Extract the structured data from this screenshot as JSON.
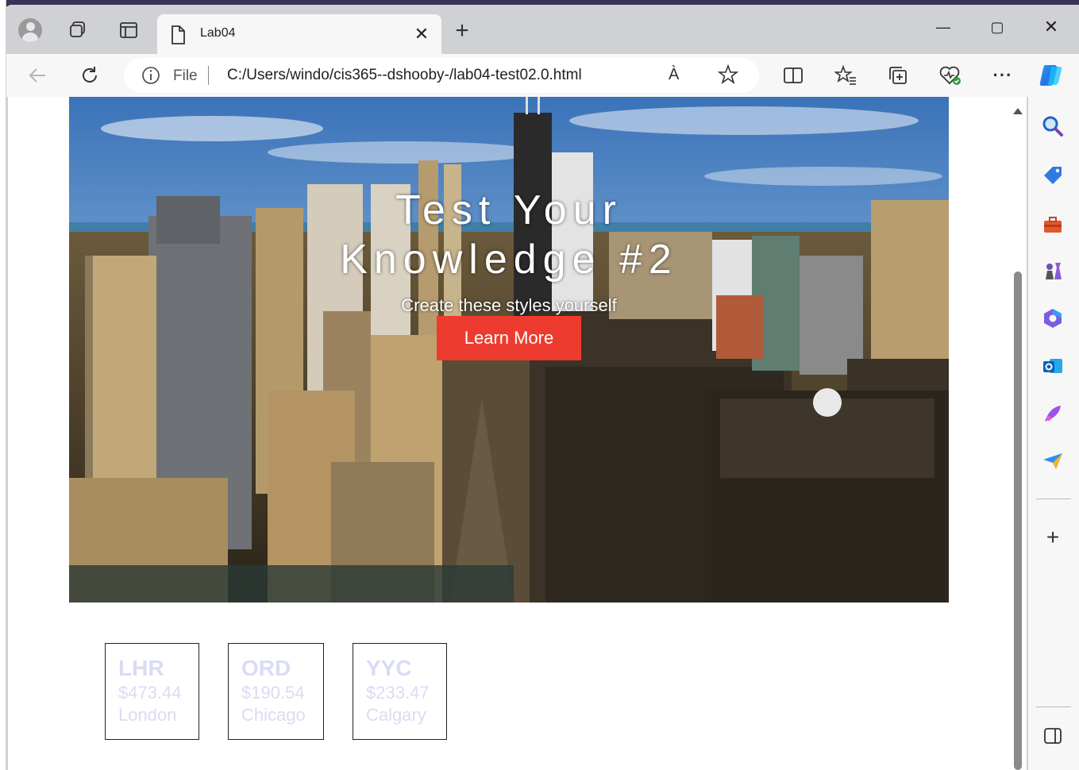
{
  "browser": {
    "tab": {
      "title": "Lab04",
      "close_glyph": "✕"
    },
    "new_tab_glyph": "+",
    "window_controls": {
      "minimize": "—",
      "maximize": "▢",
      "close": "✕"
    },
    "address_bar": {
      "scheme_label": "File",
      "url": "C:/Users/windo/cis365--dshooby-/lab04-test02.0.html",
      "read_aloud_glyph": "À"
    },
    "more_glyph": "···",
    "sidebar_add_glyph": "+"
  },
  "page": {
    "hero": {
      "title_line1": "Test Your",
      "title_line2": "Knowledge #2",
      "subtitle": "Create these styles yourself",
      "button_label": "Learn More"
    },
    "cards": [
      {
        "code": "LHR",
        "price": "$473.44",
        "city": "London"
      },
      {
        "code": "ORD",
        "price": "$190.54",
        "city": "Chicago"
      },
      {
        "code": "YYC",
        "price": "$233.47",
        "city": "Calgary"
      }
    ]
  },
  "colors": {
    "accent_button": "#ee3b2f",
    "card_text": "#d9dcf4",
    "browser_chrome": "#cfd1d4"
  },
  "icons": {
    "toolbar": [
      "back-icon",
      "reload-icon",
      "info-icon",
      "read-aloud-icon",
      "favorite-star-icon",
      "split-screen-icon",
      "favorites-icon",
      "collections-icon",
      "browser-essentials-icon",
      "more-icon",
      "copilot-icon"
    ],
    "sidebar": [
      "search-icon",
      "shopping-tag-icon",
      "tools-icon",
      "games-icon",
      "microsoft-365-icon",
      "outlook-icon",
      "designer-icon",
      "send-icon",
      "add-icon",
      "sidebar-panel-icon"
    ]
  }
}
